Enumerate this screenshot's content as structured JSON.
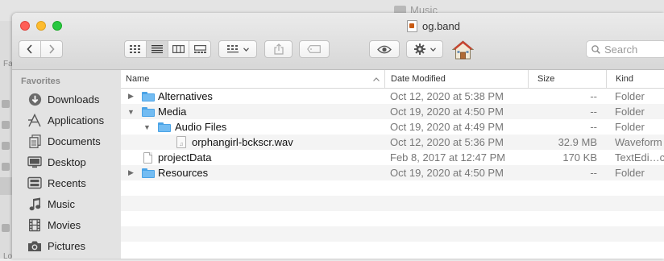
{
  "background_window": {
    "title": "Music",
    "sidebar_header_fragment": "Fa",
    "bottom_fragment": "Lo"
  },
  "window": {
    "title": "og.band"
  },
  "toolbar": {
    "view_modes": [
      "icon-view-icon",
      "list-view-icon",
      "column-view-icon",
      "gallery-view-icon"
    ],
    "selected_view": "list",
    "search_placeholder": "Search"
  },
  "sidebar": {
    "section_title": "Favorites",
    "items": [
      {
        "label": "Downloads",
        "icon": "downloads-icon"
      },
      {
        "label": "Applications",
        "icon": "applications-icon"
      },
      {
        "label": "Documents",
        "icon": "documents-icon"
      },
      {
        "label": "Desktop",
        "icon": "desktop-icon"
      },
      {
        "label": "Recents",
        "icon": "recents-icon"
      },
      {
        "label": "Music",
        "icon": "music-icon"
      },
      {
        "label": "Movies",
        "icon": "movies-icon"
      },
      {
        "label": "Pictures",
        "icon": "pictures-icon"
      }
    ]
  },
  "columns": {
    "name": "Name",
    "date": "Date Modified",
    "size": "Size",
    "kind": "Kind"
  },
  "rows": [
    {
      "name": "Alternatives",
      "date": "Oct 12, 2020 at 5:38 PM",
      "size": "--",
      "kind": "Folder",
      "type": "folder",
      "disclosure": "collapsed"
    },
    {
      "name": "Media",
      "date": "Oct 19, 2020 at 4:50 PM",
      "size": "--",
      "kind": "Folder",
      "type": "folder",
      "disclosure": "expanded"
    },
    {
      "name": "Audio Files",
      "date": "Oct 19, 2020 at 4:49 PM",
      "size": "--",
      "kind": "Folder",
      "type": "folder",
      "disclosure": "expanded"
    },
    {
      "name": "orphangirl-bckscr.wav",
      "date": "Oct 12, 2020 at 5:36 PM",
      "size": "32.9 MB",
      "kind": "Waveform",
      "type": "audio-file",
      "disclosure": "none"
    },
    {
      "name": "projectData",
      "date": "Feb 8, 2017 at 12:47 PM",
      "size": "170 KB",
      "kind": "TextEdi…cument",
      "type": "file",
      "disclosure": "none"
    },
    {
      "name": "Resources",
      "date": "Oct 19, 2020 at 4:50 PM",
      "size": "--",
      "kind": "Folder",
      "type": "folder",
      "disclosure": "collapsed"
    }
  ],
  "colors": {
    "close": "#fe5f57",
    "minimize": "#febc2e",
    "zoom": "#28c840",
    "folder": "#73bcf2",
    "sidebar_bg": "#e3e3e3"
  }
}
